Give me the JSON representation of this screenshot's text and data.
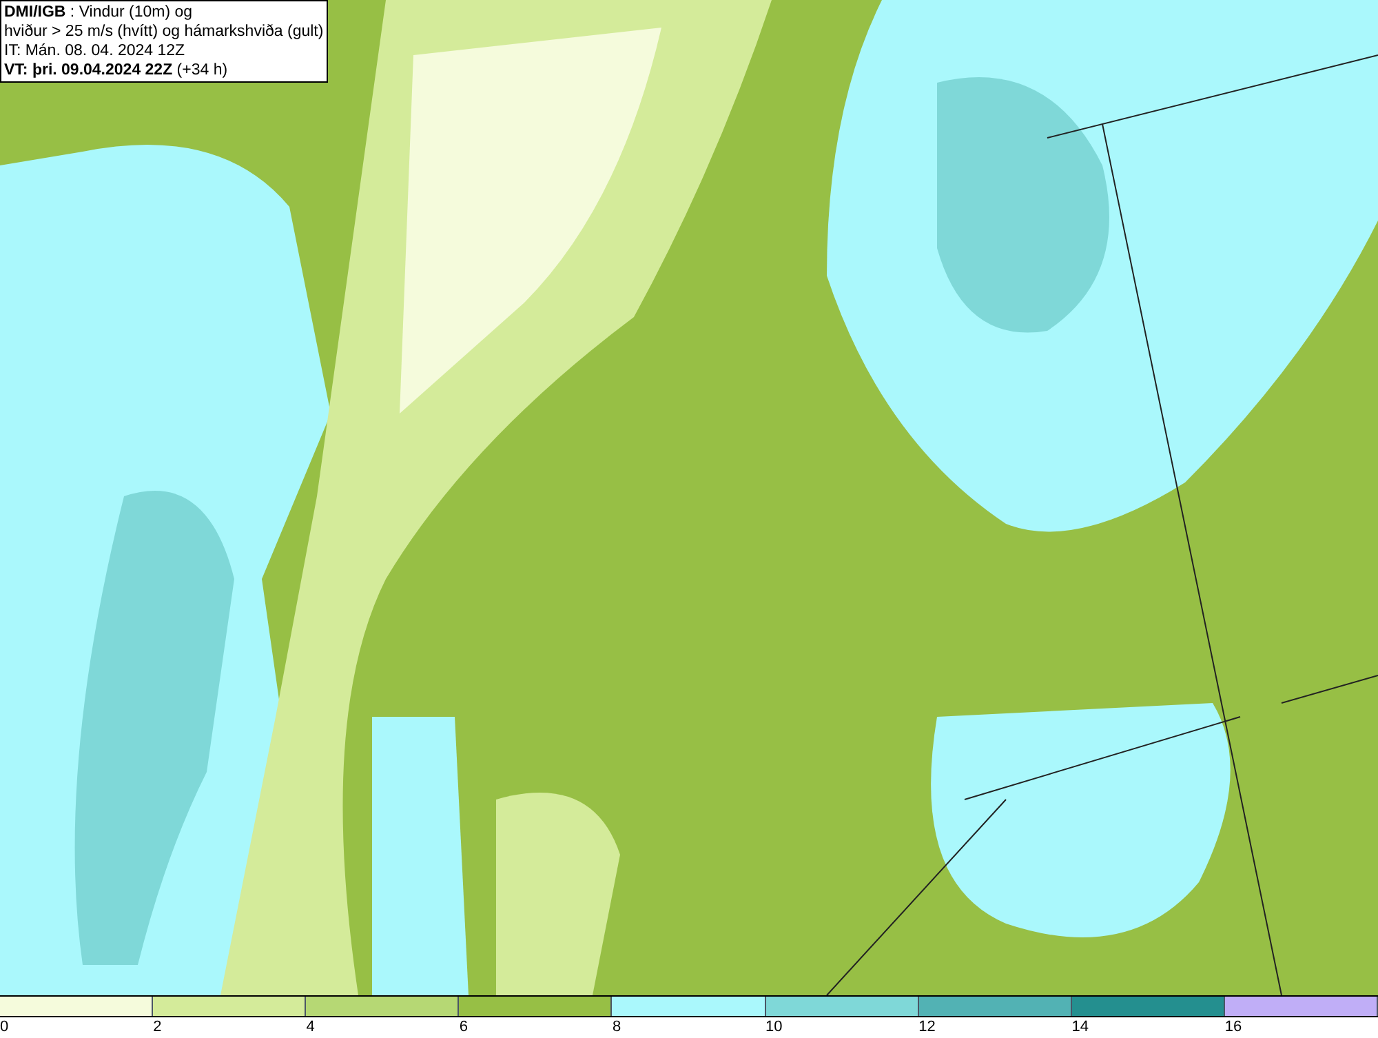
{
  "title_box": {
    "lines": [
      "**DMI/IGB** : Vindur (10m) og",
      "hviður > 25 m/s (hvítt) og hámarkshviða (gult)",
      "IT: Mán. 08. 04. 2024 12Z",
      "**VT: þri. 09.04.2024 22Z** (+34 h)"
    ]
  },
  "legend": {
    "bins": [
      {
        "color": "#f5fbdc",
        "label": "0"
      },
      {
        "color": "#d4eb9a",
        "label": "2"
      },
      {
        "color": "#b6d874",
        "label": "4"
      },
      {
        "color": "#97bf45",
        "label": "6"
      },
      {
        "color": "#aaf8fc",
        "label": "8"
      },
      {
        "color": "#7fd8d8",
        "label": "10"
      },
      {
        "color": "#52b2b4",
        "label": "12"
      },
      {
        "color": "#248f8f",
        "label": "14"
      },
      {
        "color": "#c0aef7",
        "label": "16"
      }
    ]
  }
}
